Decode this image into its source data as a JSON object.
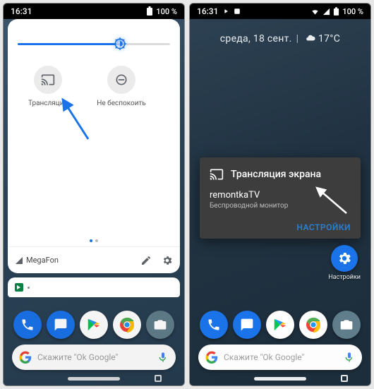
{
  "status": {
    "time": "16:31",
    "battery": "100 %"
  },
  "panel": {
    "tiles": [
      {
        "label": "Трансляция"
      },
      {
        "label": "Не беспокоить"
      }
    ],
    "carrier": "MegaFon"
  },
  "date": {
    "day": "среда, 18 сент.",
    "temp": "17°C"
  },
  "dialog": {
    "title": "Трансляция экрана",
    "device": "remontkaTV",
    "subtitle": "Беспроводной монитор",
    "button": "НАСТРОЙКИ"
  },
  "gear": {
    "label": "Настройки"
  },
  "search": {
    "hint": "Скажите \"Ok Google\""
  }
}
